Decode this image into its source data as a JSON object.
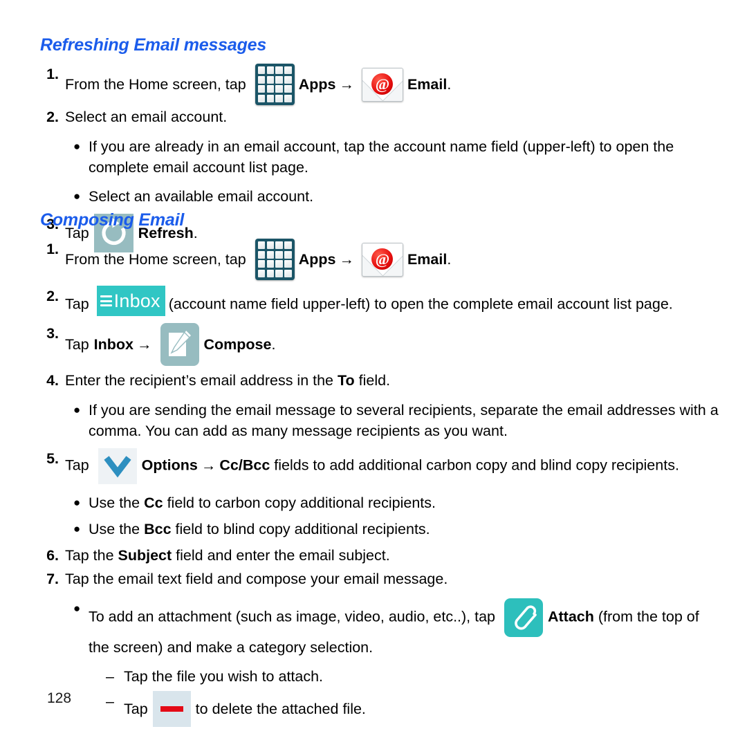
{
  "document": {
    "page_number": "128"
  },
  "sections": [
    {
      "heading": "Refreshing Email messages",
      "steps": [
        {
          "num": "1.",
          "pre": "From the Home screen, tap",
          "icon1": "apps-icon",
          "mid": "Apps",
          "arrow": "→",
          "icon2": "email-icon",
          "post": "Email",
          "period": "."
        },
        {
          "num": "2.",
          "text": "Select an email account."
        }
      ],
      "bullets": [
        "If you are already in an email account, tap the account name field (upper-left) to open the complete email account list page.",
        "Select an available email account."
      ],
      "step3": {
        "num": "3.",
        "pre": "Tap",
        "icon": "refresh-icon",
        "label": "Refresh",
        "period": "."
      }
    },
    {
      "heading": "Composing Email",
      "step1": {
        "num": "1.",
        "pre": "From the Home screen, tap",
        "icon1": "apps-icon",
        "mid": "Apps",
        "arrow": "→",
        "icon2": "email-icon",
        "post": "Email",
        "period": "."
      },
      "step2": {
        "num": "2.",
        "pre": "Tap",
        "icon": "inbox-icon",
        "icon_label": "Inbox",
        "post": "(account name field upper-left) to open the complete email account list page."
      },
      "step3": {
        "num": "3.",
        "pre": "Tap",
        "bold1": "Inbox",
        "arrow": "→",
        "icon": "compose-icon",
        "label": "Compose",
        "period": "."
      },
      "step4": {
        "num": "4.",
        "pre": "Enter the recipient’s email address in the",
        "bold": "To",
        "post": "field."
      },
      "bullet_recipients": "If you are sending the email message to several recipients, separate the email addresses with a comma. You can add as many message recipients as you want.",
      "step5": {
        "num": "5.",
        "pre": "Tap",
        "icon": "options-chevron-icon",
        "bold1": "Options",
        "arrow": "→",
        "bold2": "Cc/Bcc",
        "post": "fields to add additional carbon copy and blind copy recipients."
      },
      "bullets_cc": [
        {
          "pre": "Use the",
          "bold": "Cc",
          "post": "field to carbon copy additional recipients."
        },
        {
          "pre": "Use the",
          "bold": "Bcc",
          "post": "field to blind copy additional recipients."
        }
      ],
      "step6": {
        "num": "6.",
        "pre": "Tap the",
        "bold": "Subject",
        "post": "field and enter the email subject."
      },
      "step7": {
        "num": "7.",
        "text": "Tap the email text field and compose your email message."
      },
      "bullet_attach": {
        "pre": "To add an attachment (such as image, video, audio, etc..), tap",
        "icon": "attach-icon",
        "bold": "Attach",
        "post": "(from the top of the screen) and make a category selection."
      },
      "dashes": [
        {
          "text": "Tap the file you wish to attach."
        },
        {
          "pre": "Tap",
          "icon": "delete-icon",
          "post": "to delete the attached file."
        }
      ]
    }
  ],
  "colors": {
    "heading_blue": "#1b5ceb",
    "apps_icon_bg": "#1b5567",
    "refresh_icon_bg": "#97bcc0",
    "inbox_icon_bg": "#30c6c4",
    "compose_icon_bg": "#97bcc0",
    "attach_icon_bg": "#2dbfbc",
    "delete_icon_bg": "#d9e5ec",
    "delete_bar_red": "#e40a16",
    "options_chevron_blue": "#2d8fc0",
    "email_at_red": "#e50d0d"
  }
}
